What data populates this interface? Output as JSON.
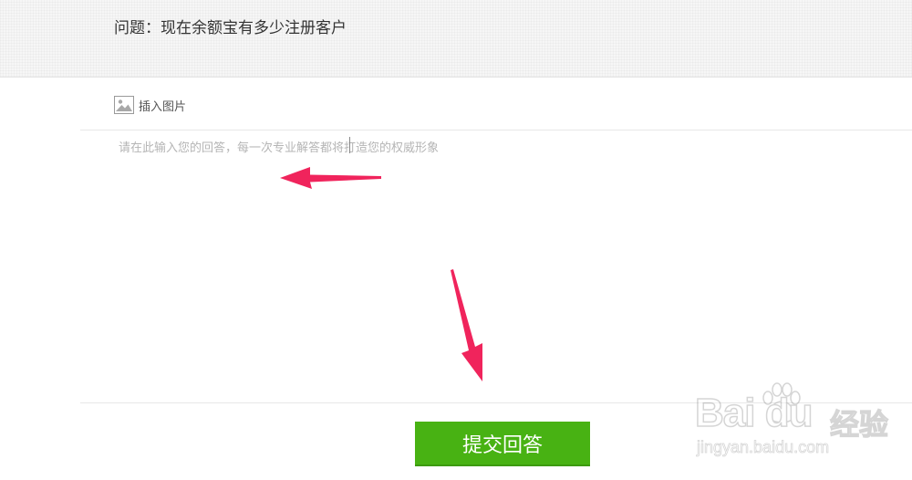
{
  "question": {
    "title": "问题：现在余额宝有多少注册客户"
  },
  "toolbar": {
    "insert_image_label": "插入图片",
    "insert_image_icon": "image-icon"
  },
  "answer": {
    "placeholder": "请在此输入您的回答，每一次专业解答都将打造您的权威形象",
    "value": ""
  },
  "submit": {
    "label": "提交回答",
    "color": "#48b213"
  },
  "annotations": {
    "arrow_color": "#f0245c"
  },
  "watermark": {
    "brand_latin": "Bai  du",
    "brand_cn": "经验",
    "url": "jingyan.baidu.com"
  }
}
